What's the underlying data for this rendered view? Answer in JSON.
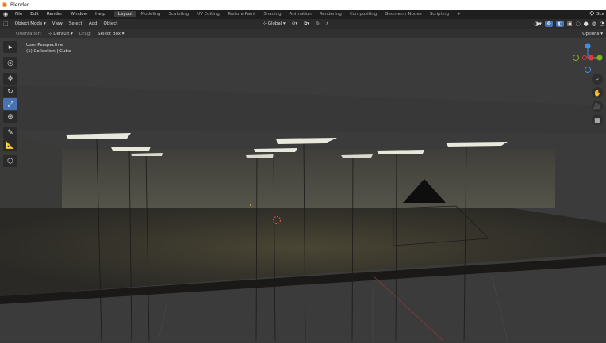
{
  "window": {
    "title": "Blender"
  },
  "menubar": {
    "items": [
      "File",
      "Edit",
      "Render",
      "Window",
      "Help"
    ],
    "workspaces": [
      "Layout",
      "Modeling",
      "Sculpting",
      "UV Editing",
      "Texture Paint",
      "Shading",
      "Animation",
      "Rendering",
      "Compositing",
      "Geometry Nodes",
      "Scripting"
    ],
    "active_workspace": "Layout",
    "add_tab": "+",
    "scene_label": "Sce"
  },
  "header": {
    "mode": "Object Mode",
    "menus": [
      "View",
      "Select",
      "Add",
      "Object"
    ],
    "transform_orientation": "Global"
  },
  "header2": {
    "orientation_label": "Orientation:",
    "orientation_value": "Default",
    "drag_label": "Drag:",
    "drag_value": "Select Box",
    "options_label": "Options"
  },
  "viewport": {
    "perspective": "User Perspective",
    "collection": "(1) Collection | Cube"
  },
  "colors": {
    "active_tool": "#4772b3",
    "gizmo_x": "#e0334b",
    "gizmo_y": "#7bb51c",
    "gizmo_z": "#3d8ee6",
    "cursor": "#e05a5a"
  },
  "icons": {
    "toolbar": [
      "select-box-icon",
      "cursor-icon",
      "move-icon",
      "rotate-icon",
      "scale-icon",
      "transform-icon",
      "annotate-icon",
      "measure-icon",
      "add-cube-icon"
    ],
    "nav": [
      "zoom-icon",
      "pan-hand-icon",
      "camera-icon",
      "grid-icon"
    ]
  }
}
